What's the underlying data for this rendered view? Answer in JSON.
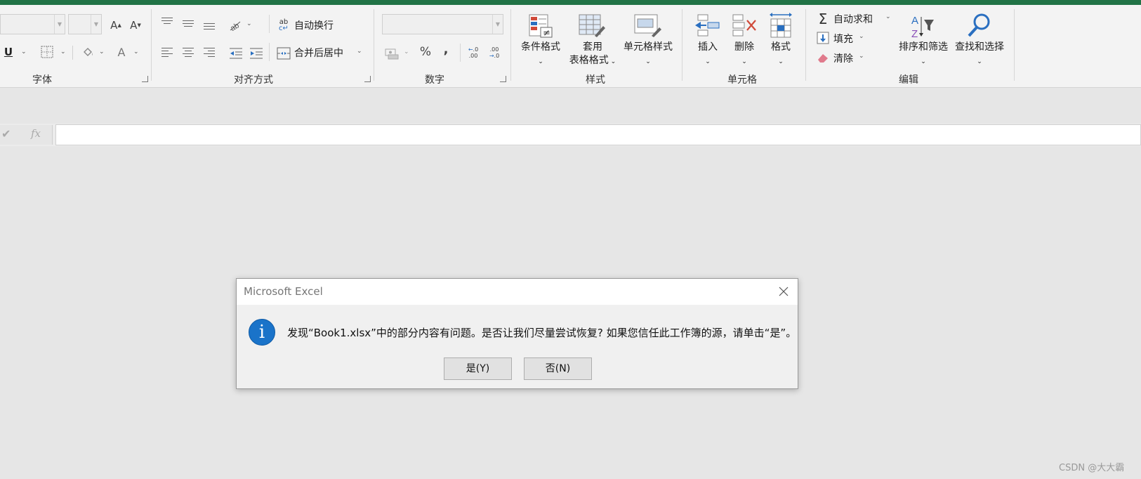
{
  "ribbon": {
    "groups": {
      "font": "字体",
      "alignment": "对齐方式",
      "number": "数字",
      "styles": "样式",
      "cells": "单元格",
      "editing": "编辑"
    },
    "alignment": {
      "wrap_text": "自动换行",
      "merge_center": "合并后居中"
    },
    "font": {
      "increase_size": "A",
      "decrease_size": "A",
      "underline": "U",
      "font_color": "A"
    },
    "number": {
      "percent": "%",
      "comma": ","
    },
    "styles": {
      "conditional_formatting": "条件格式",
      "format_as_table_line1": "套用",
      "format_as_table_line2": "表格格式",
      "cell_styles": "单元格样式"
    },
    "cells": {
      "insert": "插入",
      "delete": "删除",
      "format": "格式"
    },
    "editing": {
      "autosum": "自动求和",
      "fill": "填充",
      "clear": "清除",
      "sort_filter": "排序和筛选",
      "find_select": "查找和选择"
    }
  },
  "formula_bar": {
    "fx": "fx",
    "value": ""
  },
  "dialog": {
    "title": "Microsoft Excel",
    "message": "发现“Book1.xlsx”中的部分内容有问题。是否让我们尽量尝试恢复? 如果您信任此工作簿的源，请单击“是”。",
    "yes_label": "是(Y)",
    "no_label": "否(N)"
  },
  "watermark": "CSDN @大大霸",
  "colors": {
    "accent_green": "#217346",
    "info_blue": "#1a73c9"
  },
  "icons": [
    "checkmark-icon",
    "close-icon",
    "info-icon",
    "sigma-icon",
    "magnifier-icon",
    "eraser-icon"
  ]
}
